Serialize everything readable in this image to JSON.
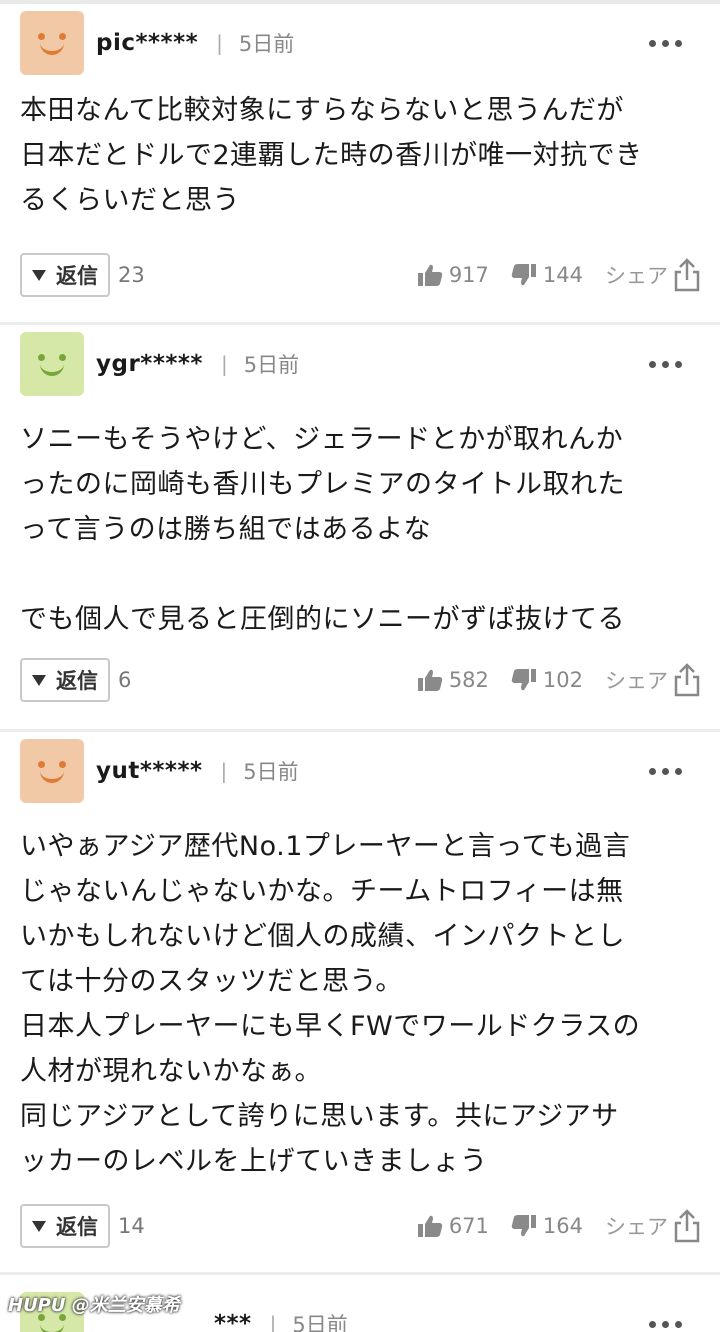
{
  "comments": [
    {
      "username": "pic*****",
      "time": "5日前",
      "avatar_bg": "#f2c9a6",
      "avatar_face": "#e07a35",
      "text": "本田なんて比較対象にすらならないと思うんだが\n日本だとドルで2連覇した時の香川が唯一対抗でき\nるくらいだと思う",
      "reply_label": "返信",
      "reply_count": "23",
      "likes": "917",
      "dislikes": "144",
      "share_label": "シェア"
    },
    {
      "username": "ygr*****",
      "time": "5日前",
      "avatar_bg": "#d6e8a8",
      "avatar_face": "#7aa637",
      "text": "ソニーもそうやけど、ジェラードとかが取れんか\nったのに岡崎も香川もプレミアのタイトル取れた\nって言うのは勝ち組ではあるよな\n\nでも個人で見ると圧倒的にソニーがずば抜けてる",
      "reply_label": "返信",
      "reply_count": "6",
      "likes": "582",
      "dislikes": "102",
      "share_label": "シェア"
    },
    {
      "username": "yut*****",
      "time": "5日前",
      "avatar_bg": "#f2c9a6",
      "avatar_face": "#e07a35",
      "text": "いやぁアジア歴代No.1プレーヤーと言っても過言\nじゃないんじゃないかな。チームトロフィーは無\nいかもしれないけど個人の成績、インパクトとし\nては十分のスタッツだと思う。\n日本人プレーヤーにも早くFWでワールドクラスの\n人材が現れないかなぁ。\n同じアジアとして誇りに思います。共にアジアサ\nッカーのレベルを上げていきましょう",
      "reply_label": "返信",
      "reply_count": "14",
      "likes": "671",
      "dislikes": "164",
      "share_label": "シェア"
    },
    {
      "username": "***",
      "time": "5日前",
      "avatar_bg": "#d6e8a8",
      "avatar_face": "#7aa637"
    }
  ],
  "watermark": "HUPU @米兰安慕希"
}
